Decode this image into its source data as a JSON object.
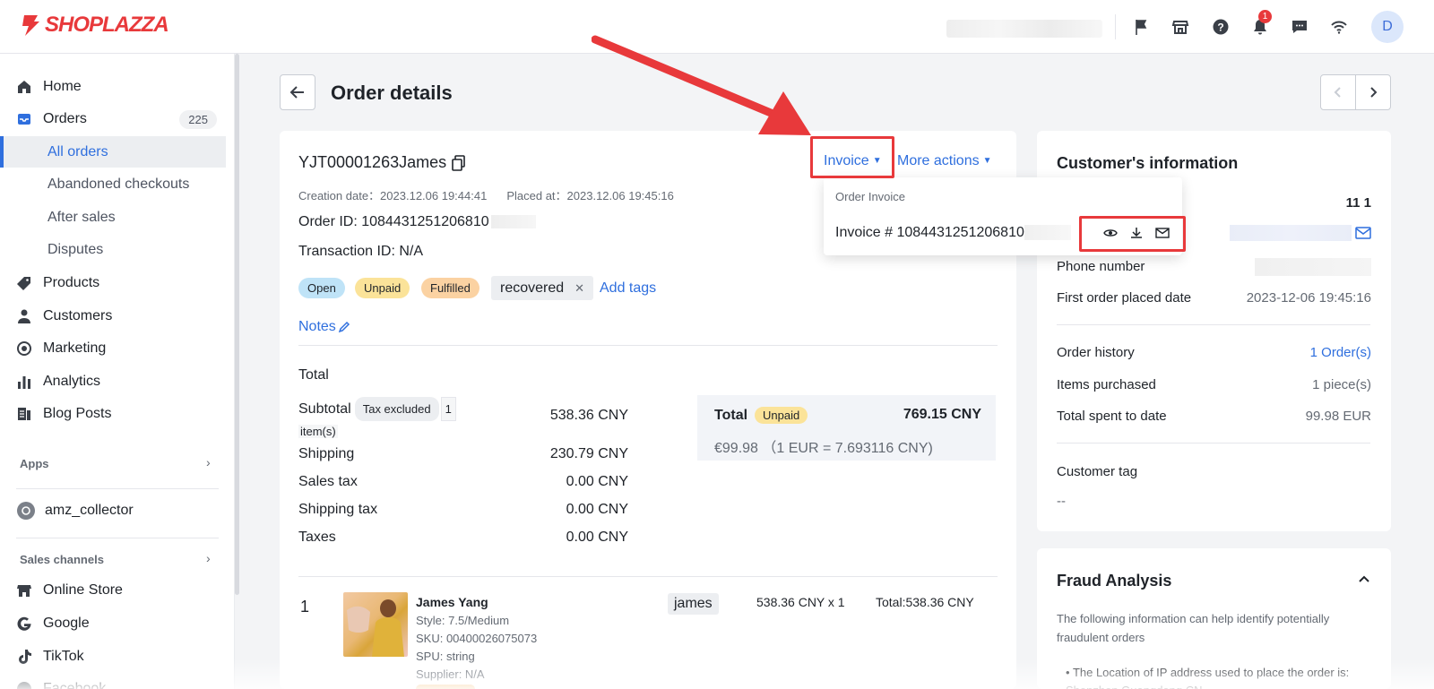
{
  "brand": {
    "name": "SHOPLAZZA",
    "accent": "#e8393b",
    "link": "#2f6fde"
  },
  "topbar": {
    "notification_count": "1",
    "avatar_initial": "D",
    "icons": [
      "flag-icon",
      "store-icon",
      "help-icon",
      "bell-icon",
      "chat-icon",
      "wifi-icon"
    ]
  },
  "sidebar": {
    "items": [
      {
        "label": "Home"
      },
      {
        "label": "Orders",
        "count": "225"
      },
      {
        "label": "All orders"
      },
      {
        "label": "Abandoned checkouts"
      },
      {
        "label": "After sales"
      },
      {
        "label": "Disputes"
      },
      {
        "label": "Products"
      },
      {
        "label": "Customers"
      },
      {
        "label": "Marketing"
      },
      {
        "label": "Analytics"
      },
      {
        "label": "Blog Posts"
      }
    ],
    "apps_label": "Apps",
    "app_item": "amz_collector",
    "channels_label": "Sales channels",
    "channels": [
      {
        "label": "Online Store"
      },
      {
        "label": "Google"
      },
      {
        "label": "TikTok"
      },
      {
        "label": "Facebook"
      }
    ]
  },
  "page": {
    "title": "Order details"
  },
  "order": {
    "number": "YJT00001263James",
    "creation": "Creation date：2023.12.06 19:44:41",
    "placed": "Placed at：2023.12.06 19:45:16",
    "order_id": "Order ID: 1084431251206810",
    "transaction_id": "Transaction ID: N/A",
    "tags": [
      "Open",
      "Unpaid",
      "Fulfilled"
    ],
    "custom_tag": "recovered",
    "add_tags": "Add tags",
    "notes": "Notes",
    "invoice_label": "Invoice",
    "more_actions_label": "More actions"
  },
  "invoice_menu": {
    "header": "Order Invoice",
    "item": "Invoice # 1084431251206810",
    "icons": [
      "view-icon",
      "download-icon",
      "email-icon"
    ]
  },
  "summary": {
    "title": "Total",
    "subtotal_label": "Subtotal",
    "tax_excluded": "Tax excluded",
    "item_count": "1",
    "items_suffix": "item(s)",
    "subtotal": "538.36 CNY",
    "shipping_label": "Shipping",
    "shipping": "230.79 CNY",
    "sales_tax_label": "Sales tax",
    "sales_tax": "0.00 CNY",
    "shipping_tax_label": "Shipping tax",
    "shipping_tax": "0.00 CNY",
    "taxes_label": "Taxes",
    "taxes": "0.00 CNY",
    "total_label": "Total",
    "total_status": "Unpaid",
    "total": "769.15 CNY",
    "eur_line": "€99.98 （1 EUR = 7.693116 CNY)"
  },
  "line_item": {
    "index": "1",
    "name": "James Yang",
    "style": "Style: 7.5/Medium",
    "sku": "SKU: 00400026075073",
    "spu": "SPU: string",
    "supplier": "Supplier: N/A",
    "tag": "james",
    "price": "538.36 CNY x 1",
    "total": "Total:538.36 CNY"
  },
  "customer": {
    "title": "Customer's information",
    "name_value": "11 1",
    "phone_label": "Phone number",
    "first_order_label": "First order placed date",
    "first_order": "2023-12-06 19:45:16",
    "history_label": "Order history",
    "history": "1 Order(s)",
    "items_label": "Items purchased",
    "items": "1 piece(s)",
    "spent_label": "Total spent to date",
    "spent": "99.98 EUR",
    "tag_label": "Customer tag",
    "tag": "--"
  },
  "fraud": {
    "title": "Fraud Analysis",
    "desc": "The following information can help identify potentially fraudulent orders",
    "bullet": "The Location of IP address used to place the order is: Shenzhen,Guangdong,CN"
  }
}
